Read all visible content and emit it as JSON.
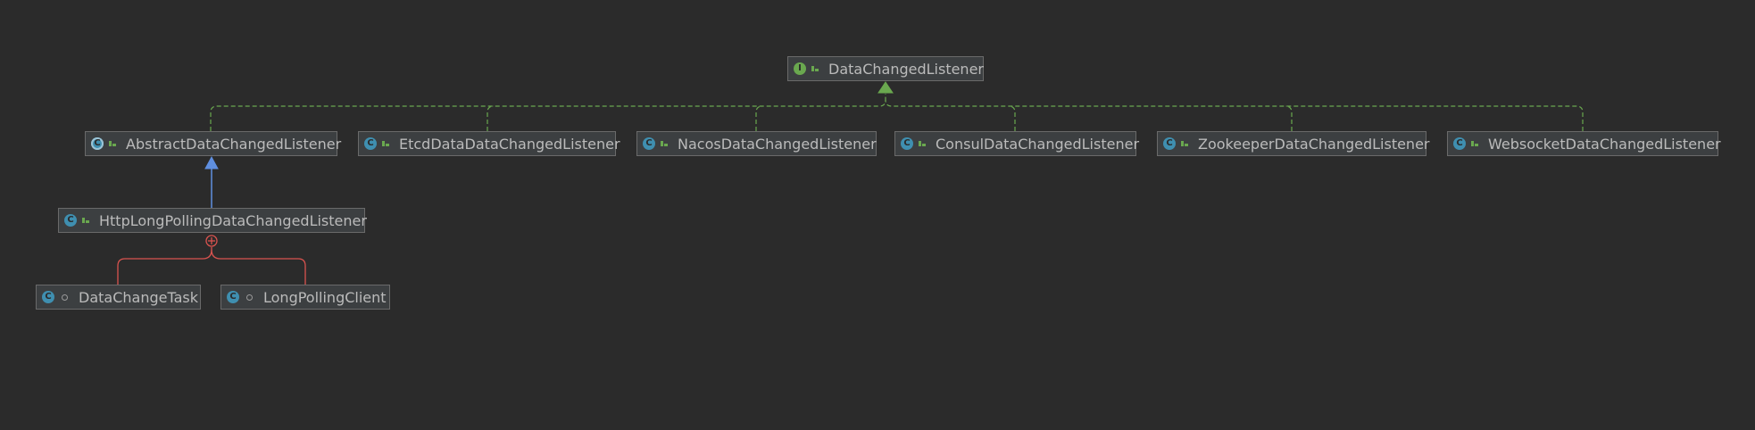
{
  "colors": {
    "background": "#2b2b2b",
    "node_fill": "#3c3f41",
    "node_border": "#6a6a6a",
    "node_text": "#bbbbbb",
    "implements_edge": "#6aa84f",
    "extends_edge": "#5f8fe0",
    "inner_class_edge": "#d9534f",
    "interface_badge": "#6aa84f",
    "class_badge": "#3f8fb0"
  },
  "nodes": {
    "data_changed_listener": {
      "label": "DataChangedListener",
      "kind": "interface",
      "badge_letter": "I",
      "access": "public"
    },
    "abstract_data_changed_listener": {
      "label": "AbstractDataChangedListener",
      "kind": "abstract-class",
      "badge_letter": "C",
      "access": "public"
    },
    "etcd_data_data_changed_listener": {
      "label": "EtcdDataDataChangedListener",
      "kind": "class",
      "badge_letter": "C",
      "access": "public"
    },
    "nacos_data_changed_listener": {
      "label": "NacosDataChangedListener",
      "kind": "class",
      "badge_letter": "C",
      "access": "public"
    },
    "consul_data_changed_listener": {
      "label": "ConsulDataChangedListener",
      "kind": "class",
      "badge_letter": "C",
      "access": "public"
    },
    "zookeeper_data_changed_listener": {
      "label": "ZookeeperDataChangedListener",
      "kind": "class",
      "badge_letter": "C",
      "access": "public"
    },
    "websocket_data_changed_listener": {
      "label": "WebsocketDataChangedListener",
      "kind": "class",
      "badge_letter": "C",
      "access": "public"
    },
    "http_long_polling_data_changed_listener": {
      "label": "HttpLongPollingDataChangedListener",
      "kind": "class",
      "badge_letter": "C",
      "access": "public"
    },
    "data_change_task": {
      "label": "DataChangeTask",
      "kind": "class",
      "badge_letter": "C",
      "access": "package"
    },
    "long_polling_client": {
      "label": "LongPollingClient",
      "kind": "class",
      "badge_letter": "C",
      "access": "package"
    }
  },
  "edges": [
    {
      "from": "abstract_data_changed_listener",
      "to": "data_changed_listener",
      "type": "implements"
    },
    {
      "from": "etcd_data_data_changed_listener",
      "to": "data_changed_listener",
      "type": "implements"
    },
    {
      "from": "nacos_data_changed_listener",
      "to": "data_changed_listener",
      "type": "implements"
    },
    {
      "from": "consul_data_changed_listener",
      "to": "data_changed_listener",
      "type": "implements"
    },
    {
      "from": "zookeeper_data_changed_listener",
      "to": "data_changed_listener",
      "type": "implements"
    },
    {
      "from": "websocket_data_changed_listener",
      "to": "data_changed_listener",
      "type": "implements"
    },
    {
      "from": "http_long_polling_data_changed_listener",
      "to": "abstract_data_changed_listener",
      "type": "extends"
    },
    {
      "from": "data_change_task",
      "to": "http_long_polling_data_changed_listener",
      "type": "inner-class"
    },
    {
      "from": "long_polling_client",
      "to": "http_long_polling_data_changed_listener",
      "type": "inner-class"
    }
  ]
}
